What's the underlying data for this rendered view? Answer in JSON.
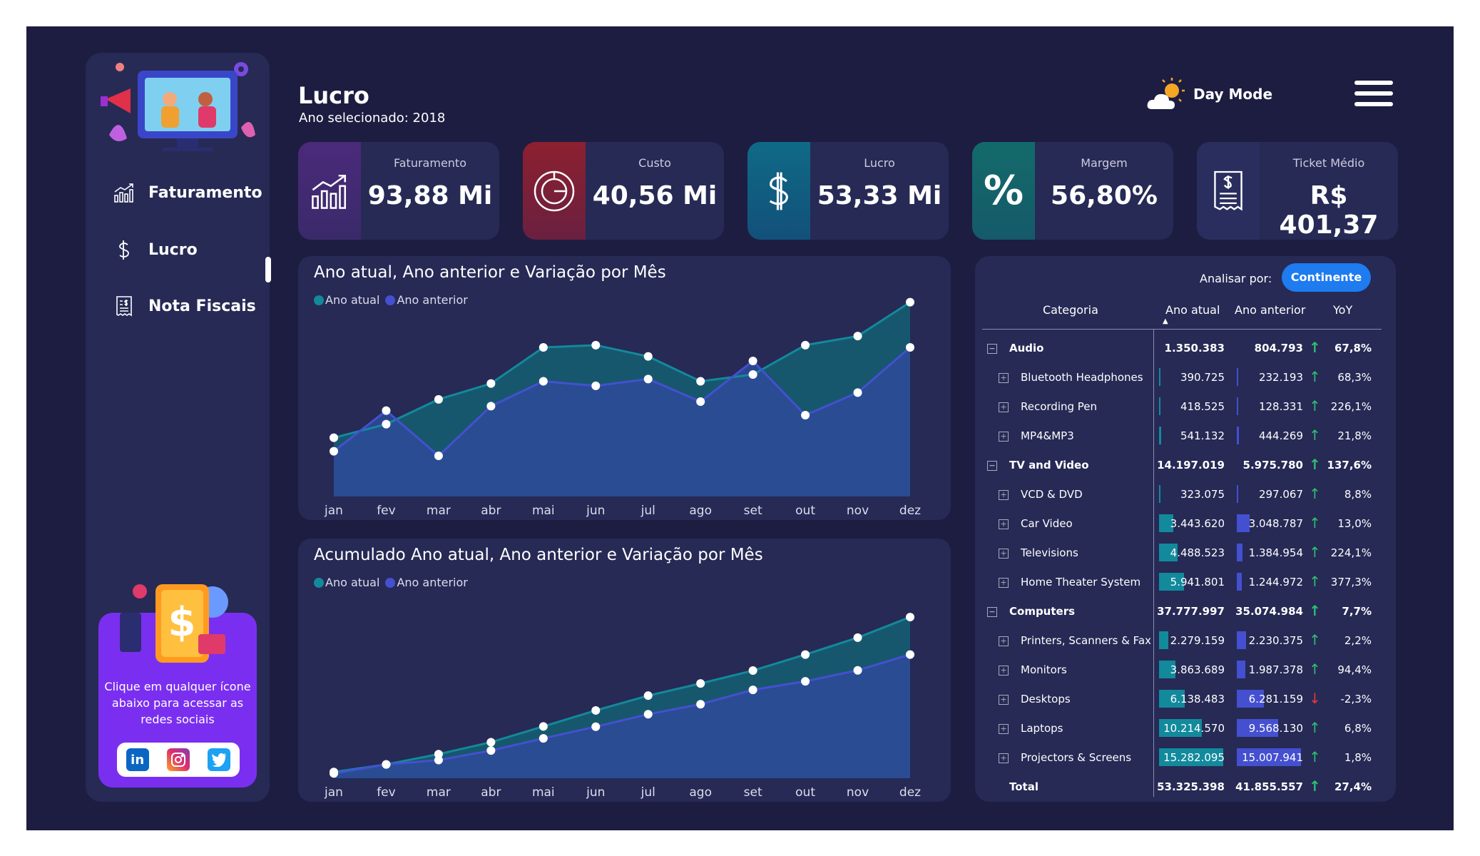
{
  "page": {
    "title": "Lucro",
    "subtitle": "Ano selecionado: 2018"
  },
  "sidebar": {
    "items": [
      {
        "label": "Faturamento",
        "icon": "chart-growth-icon"
      },
      {
        "label": "Lucro",
        "icon": "dollar-icon",
        "active": true
      },
      {
        "label": "Nota Fiscais",
        "icon": "receipt-icon"
      }
    ],
    "promo_text": "Clique em qualquer ícone abaixo para acessar as redes sociais",
    "social": [
      "linkedin-icon",
      "instagram-icon",
      "twitter-icon"
    ]
  },
  "header": {
    "daymode_label": "Day Mode"
  },
  "kpis": [
    {
      "label": "Faturamento",
      "value": "93,88 Mi",
      "icon": "chart-growth-icon",
      "color": "#4a2a7a"
    },
    {
      "label": "Custo",
      "value": "40,56 Mi",
      "icon": "target-icon",
      "color": "#8c2030"
    },
    {
      "label": "Lucro",
      "value": "53,33 Mi",
      "icon": "dollar-icon",
      "color": "#0f6a86"
    },
    {
      "label": "Margem",
      "value": "56,80%",
      "icon": "percent-icon",
      "color": "#136a6a"
    },
    {
      "label": "Ticket Médio",
      "value": "R$ 401,37",
      "icon": "receipt-icon",
      "color": "#2a2e5e"
    }
  ],
  "chart_data": [
    {
      "type": "area",
      "title": "Ano atual, Ano anterior e Variação por Mês",
      "categories": [
        "jan",
        "fev",
        "mar",
        "abr",
        "mai",
        "jun",
        "jul",
        "ago",
        "set",
        "out",
        "nov",
        "dez"
      ],
      "series": [
        {
          "name": "Ano atual",
          "color": "#13899a",
          "values": [
            1.3,
            1.6,
            2.15,
            2.5,
            3.3,
            3.35,
            3.1,
            2.55,
            2.7,
            3.35,
            3.55,
            4.3
          ]
        },
        {
          "name": "Ano anterior",
          "color": "#4450d0",
          "values": [
            1.0,
            1.9,
            0.9,
            2.0,
            2.55,
            2.45,
            2.6,
            2.1,
            3.0,
            1.8,
            2.3,
            3.3
          ]
        }
      ],
      "ylim": [
        0,
        4.5
      ]
    },
    {
      "type": "area",
      "title": "Acumulado Ano atual, Ano anterior e Variação por Mês",
      "categories": [
        "jan",
        "fev",
        "mar",
        "abr",
        "mai",
        "jun",
        "jul",
        "ago",
        "set",
        "out",
        "nov",
        "dez"
      ],
      "series": [
        {
          "name": "Ano atual",
          "color": "#13899a",
          "values": [
            1.3,
            2.9,
            5.05,
            7.55,
            10.85,
            14.2,
            17.3,
            19.85,
            22.55,
            25.9,
            29.45,
            33.75
          ]
        },
        {
          "name": "Ano anterior",
          "color": "#4450d0",
          "values": [
            1.0,
            2.9,
            3.8,
            5.8,
            8.35,
            10.8,
            13.4,
            15.5,
            18.5,
            20.3,
            22.6,
            25.9
          ]
        }
      ],
      "ylim": [
        0,
        36
      ]
    }
  ],
  "matrix": {
    "analisar_label": "Analisar por:",
    "button_label": "Continente",
    "headers": [
      "Categoria",
      "Ano atual",
      "Ano anterior",
      "YoY"
    ],
    "rows": [
      {
        "level": 0,
        "cat": "Audio",
        "atual": "1.350.383",
        "anterior": "804.793",
        "yoy": "67,8%",
        "up": true,
        "atual_val": 1350383,
        "anterior_val": 804793
      },
      {
        "level": 1,
        "cat": "Bluetooth Headphones",
        "atual": "390.725",
        "anterior": "232.193",
        "yoy": "68,3%",
        "up": true,
        "atual_val": 390725,
        "anterior_val": 232193
      },
      {
        "level": 1,
        "cat": "Recording Pen",
        "atual": "418.525",
        "anterior": "128.331",
        "yoy": "226,1%",
        "up": true,
        "atual_val": 418525,
        "anterior_val": 128331
      },
      {
        "level": 1,
        "cat": "MP4&MP3",
        "atual": "541.132",
        "anterior": "444.269",
        "yoy": "21,8%",
        "up": true,
        "atual_val": 541132,
        "anterior_val": 444269
      },
      {
        "level": 0,
        "cat": "TV and Video",
        "atual": "14.197.019",
        "anterior": "5.975.780",
        "yoy": "137,6%",
        "up": true,
        "atual_val": 14197019,
        "anterior_val": 5975780
      },
      {
        "level": 1,
        "cat": "VCD & DVD",
        "atual": "323.075",
        "anterior": "297.067",
        "yoy": "8,8%",
        "up": true,
        "atual_val": 323075,
        "anterior_val": 297067
      },
      {
        "level": 1,
        "cat": "Car Video",
        "atual": "3.443.620",
        "anterior": "3.048.787",
        "yoy": "13,0%",
        "up": true,
        "atual_val": 3443620,
        "anterior_val": 3048787
      },
      {
        "level": 1,
        "cat": "Televisions",
        "atual": "4.488.523",
        "anterior": "1.384.954",
        "yoy": "224,1%",
        "up": true,
        "atual_val": 4488523,
        "anterior_val": 1384954
      },
      {
        "level": 1,
        "cat": "Home Theater System",
        "atual": "5.941.801",
        "anterior": "1.244.972",
        "yoy": "377,3%",
        "up": true,
        "atual_val": 5941801,
        "anterior_val": 1244972
      },
      {
        "level": 0,
        "cat": "Computers",
        "atual": "37.777.997",
        "anterior": "35.074.984",
        "yoy": "7,7%",
        "up": true,
        "atual_val": 37777997,
        "anterior_val": 35074984
      },
      {
        "level": 1,
        "cat": "Printers, Scanners & Fax",
        "atual": "2.279.159",
        "anterior": "2.230.375",
        "yoy": "2,2%",
        "up": true,
        "atual_val": 2279159,
        "anterior_val": 2230375
      },
      {
        "level": 1,
        "cat": "Monitors",
        "atual": "3.863.689",
        "anterior": "1.987.378",
        "yoy": "94,4%",
        "up": true,
        "atual_val": 3863689,
        "anterior_val": 1987378
      },
      {
        "level": 1,
        "cat": "Desktops",
        "atual": "6.138.483",
        "anterior": "6.281.159",
        "yoy": "-2,3%",
        "up": false,
        "atual_val": 6138483,
        "anterior_val": 6281159
      },
      {
        "level": 1,
        "cat": "Laptops",
        "atual": "10.214.570",
        "anterior": "9.568.130",
        "yoy": "6,8%",
        "up": true,
        "atual_val": 10214570,
        "anterior_val": 9568130
      },
      {
        "level": 1,
        "cat": "Projectors & Screens",
        "atual": "15.282.095",
        "anterior": "15.007.941",
        "yoy": "1,8%",
        "up": true,
        "atual_val": 15282095,
        "anterior_val": 15007941
      },
      {
        "level": -1,
        "cat": "Total",
        "atual": "53.325.398",
        "anterior": "41.855.557",
        "yoy": "27,4%",
        "up": true
      }
    ],
    "colors": {
      "atual_bar": "#128a9c",
      "anterior_bar": "#4450d0",
      "up": "#2fbf71",
      "down": "#e53935"
    }
  }
}
